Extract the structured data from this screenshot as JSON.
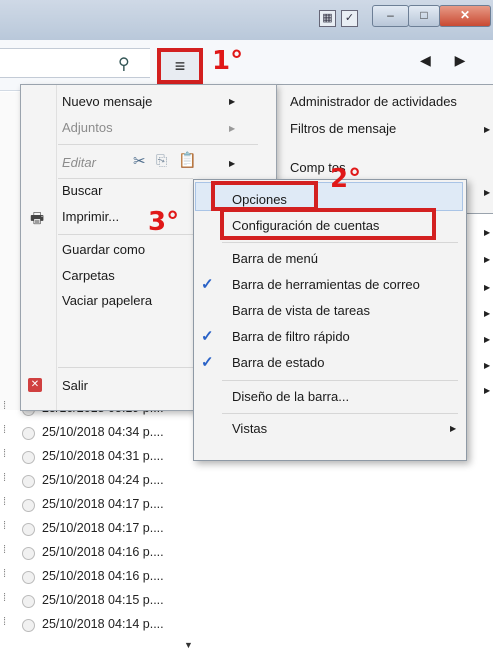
{
  "toolbar": {
    "menu_button_icon": "≡",
    "tab_arrows": "◀ ▶"
  },
  "message_list": {
    "rows": [
      {
        "date": "25/10/2018 05:19 p...."
      },
      {
        "date": "25/10/2018 04:34 p...."
      },
      {
        "date": "25/10/2018 04:31 p...."
      },
      {
        "date": "25/10/2018 04:24 p...."
      },
      {
        "date": "25/10/2018 04:17 p...."
      },
      {
        "date": "25/10/2018 04:17 p...."
      },
      {
        "date": "25/10/2018 04:16 p...."
      },
      {
        "date": "25/10/2018 04:16 p...."
      },
      {
        "date": "25/10/2018 04:15 p...."
      },
      {
        "date": "25/10/2018 04:14 p...."
      }
    ]
  },
  "main_menu": {
    "nuevo_mensaje": "Nuevo mensaje",
    "adjuntos": "Adjuntos",
    "editar": "Editar",
    "buscar": "Buscar",
    "imprimir": "Imprimir...",
    "guardar_como": "Guardar como",
    "carpetas": "Carpetas",
    "vaciar_papelera": "Vaciar papelera",
    "salir": "Salir"
  },
  "sub_menu": {
    "administrador": "Administrador de actividades",
    "filtros": "Filtros de mensaje",
    "complementos": "Comp      tos"
  },
  "options_menu": {
    "opciones": "Opciones",
    "configuracion_cuentas": "Configuración de cuentas",
    "barra_menu": "Barra de menú",
    "barra_herramientas_correo": "Barra de herramientas de correo",
    "barra_vista_tareas": "Barra de vista de tareas",
    "barra_filtro_rapido": "Barra de filtro rápido",
    "barra_estado": "Barra de estado",
    "diseno_barra": "Diseño de la barra...",
    "vistas": "Vistas"
  },
  "annotations": {
    "step1": "1°",
    "step2": "2°",
    "step3": "3°"
  },
  "colors": {
    "annotation_red": "#d32020",
    "check_blue": "#2a62c7"
  }
}
